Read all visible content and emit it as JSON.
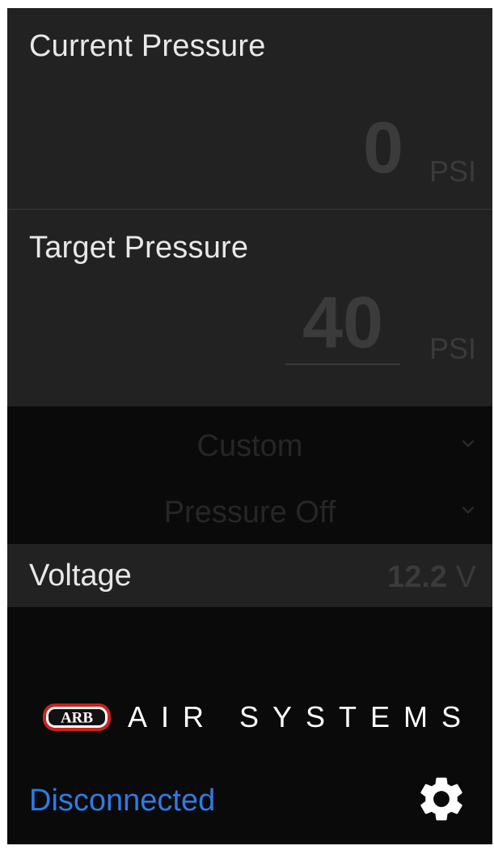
{
  "current_pressure": {
    "title": "Current Pressure",
    "value": "0",
    "unit": "PSI"
  },
  "target_pressure": {
    "title": "Target Pressure",
    "value": "40",
    "unit": "PSI"
  },
  "profile_select": {
    "selected": "Custom"
  },
  "mode_select": {
    "selected": "Pressure Off"
  },
  "voltage": {
    "label": "Voltage",
    "value": "12.2",
    "unit": "V"
  },
  "brand": {
    "logo_text": "ARB",
    "text": "AIR SYSTEMS"
  },
  "status": {
    "text": "Disconnected"
  },
  "icons": {
    "settings": "gear-icon",
    "dropdown": "chevron-down-icon"
  },
  "colors": {
    "background": "#0a0a0a",
    "panel": "#222222",
    "status_blue": "#2f7ae5",
    "logo_red": "#c8241f"
  }
}
